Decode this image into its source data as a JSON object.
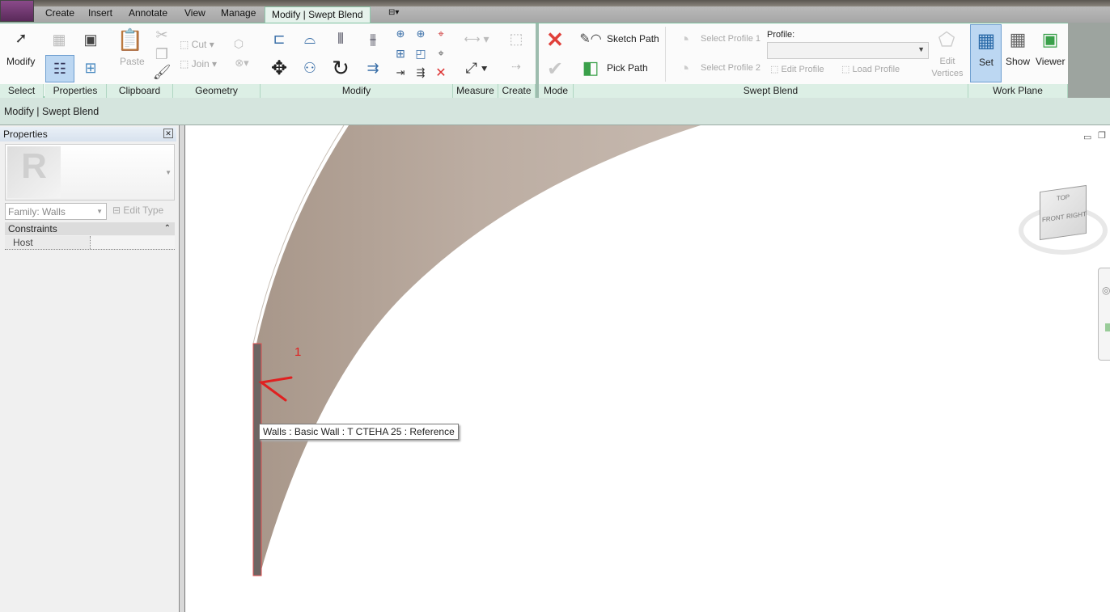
{
  "tabs": [
    "Create",
    "Insert",
    "Annotate",
    "View",
    "Manage",
    "Modify | Swept Blend"
  ],
  "active_tab": "Modify | Swept Blend",
  "ribbon": {
    "select": {
      "modify": "Modify",
      "panel": "Select"
    },
    "properties": {
      "panel": "Properties"
    },
    "clipboard": {
      "paste": "Paste",
      "panel": "Clipboard"
    },
    "geometry": {
      "cut": "Cut",
      "join": "Join",
      "panel": "Geometry"
    },
    "modify": {
      "panel": "Modify"
    },
    "measure": {
      "panel": "Measure"
    },
    "create": {
      "panel": "Create"
    },
    "mode": {
      "panel": "Mode"
    },
    "swept_blend": {
      "sketch_path": "Sketch Path",
      "pick_path": "Pick Path",
      "select_profile_1": "Select Profile 1",
      "select_profile_2": "Select Profile 2",
      "profile_label": "Profile:",
      "profile_value": "",
      "edit_profile": "Edit Profile",
      "load_profile": "Load Profile",
      "edit_vertices": "Edit Vertices",
      "panel": "Swept Blend"
    },
    "work_plane": {
      "set": "Set",
      "show": "Show",
      "viewer": "Viewer",
      "panel": "Work Plane"
    }
  },
  "options_bar": {
    "context": "Modify | Swept Blend"
  },
  "properties_panel": {
    "title": "Properties",
    "type_selector": "Family: Walls",
    "edit_type": "Edit Type",
    "section": "Constraints",
    "rows": [
      {
        "name": "Host",
        "value": ""
      }
    ]
  },
  "canvas": {
    "annotation_number": "1",
    "tooltip": "Walls : Basic Wall : T CTEHA 25 : Reference",
    "viewcube": {
      "top": "TOP",
      "front": "FRONT",
      "right": "RIGHT"
    }
  },
  "colors": {
    "accent": "#7fc2a0",
    "ribbon_label_bg": "#dcefe5",
    "selected": "#bcd7f2",
    "sweep_fill": "#b6a79b",
    "annotation": "#e02020"
  }
}
